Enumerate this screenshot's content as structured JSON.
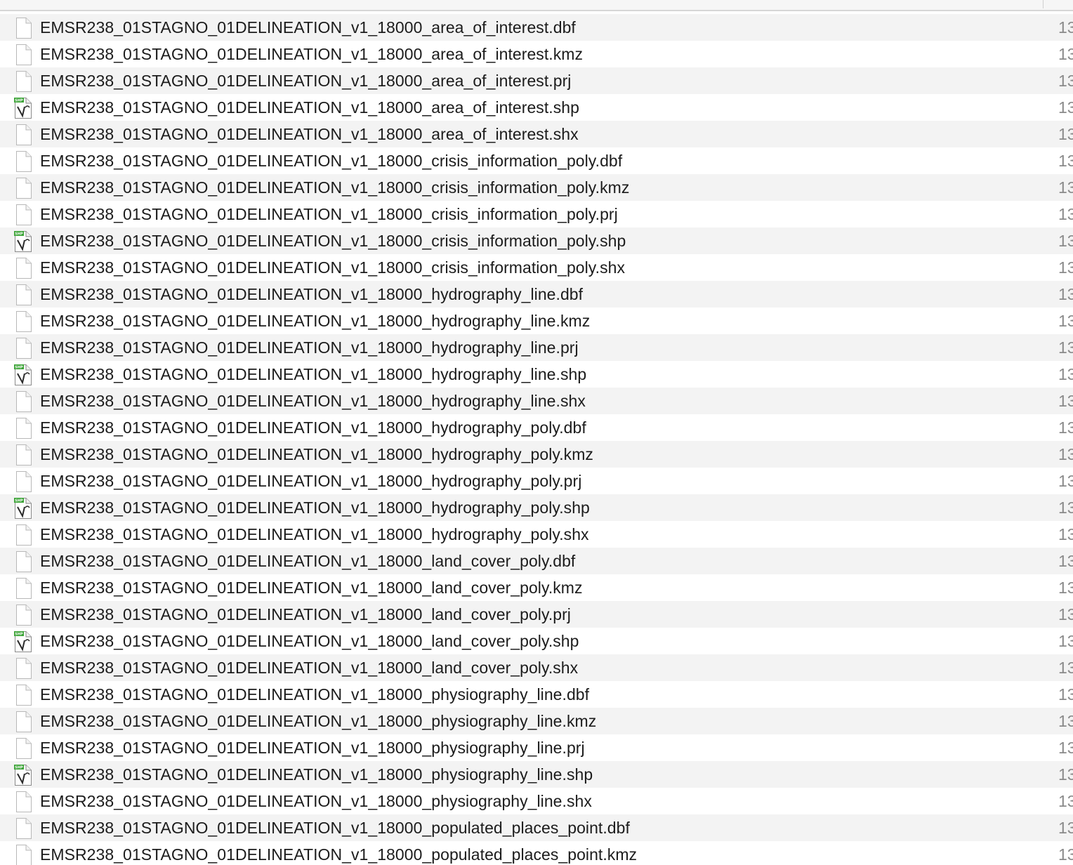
{
  "colors": {
    "row_alt": "#f3f3f3",
    "row_base": "#ffffff",
    "text": "#1c1c1c",
    "secondary_text": "#8a8a8a",
    "shp_badge": "#3aa335"
  },
  "files": [
    {
      "name": "EMSR238_01STAGNO_01DELINEATION_v1_18000_area_of_interest.dbf",
      "icon": "document-icon",
      "extra": "13"
    },
    {
      "name": "EMSR238_01STAGNO_01DELINEATION_v1_18000_area_of_interest.kmz",
      "icon": "document-icon",
      "extra": "13"
    },
    {
      "name": "EMSR238_01STAGNO_01DELINEATION_v1_18000_area_of_interest.prj",
      "icon": "document-icon",
      "extra": "13"
    },
    {
      "name": "EMSR238_01STAGNO_01DELINEATION_v1_18000_area_of_interest.shp",
      "icon": "shapefile-icon",
      "extra": "13"
    },
    {
      "name": "EMSR238_01STAGNO_01DELINEATION_v1_18000_area_of_interest.shx",
      "icon": "document-icon",
      "extra": "13"
    },
    {
      "name": "EMSR238_01STAGNO_01DELINEATION_v1_18000_crisis_information_poly.dbf",
      "icon": "document-icon",
      "extra": "13"
    },
    {
      "name": "EMSR238_01STAGNO_01DELINEATION_v1_18000_crisis_information_poly.kmz",
      "icon": "document-icon",
      "extra": "13"
    },
    {
      "name": "EMSR238_01STAGNO_01DELINEATION_v1_18000_crisis_information_poly.prj",
      "icon": "document-icon",
      "extra": "13"
    },
    {
      "name": "EMSR238_01STAGNO_01DELINEATION_v1_18000_crisis_information_poly.shp",
      "icon": "shapefile-icon",
      "extra": "13"
    },
    {
      "name": "EMSR238_01STAGNO_01DELINEATION_v1_18000_crisis_information_poly.shx",
      "icon": "document-icon",
      "extra": "13"
    },
    {
      "name": "EMSR238_01STAGNO_01DELINEATION_v1_18000_hydrography_line.dbf",
      "icon": "document-icon",
      "extra": "13"
    },
    {
      "name": "EMSR238_01STAGNO_01DELINEATION_v1_18000_hydrography_line.kmz",
      "icon": "document-icon",
      "extra": "13"
    },
    {
      "name": "EMSR238_01STAGNO_01DELINEATION_v1_18000_hydrography_line.prj",
      "icon": "document-icon",
      "extra": "13"
    },
    {
      "name": "EMSR238_01STAGNO_01DELINEATION_v1_18000_hydrography_line.shp",
      "icon": "shapefile-icon",
      "extra": "13"
    },
    {
      "name": "EMSR238_01STAGNO_01DELINEATION_v1_18000_hydrography_line.shx",
      "icon": "document-icon",
      "extra": "13"
    },
    {
      "name": "EMSR238_01STAGNO_01DELINEATION_v1_18000_hydrography_poly.dbf",
      "icon": "document-icon",
      "extra": "13"
    },
    {
      "name": "EMSR238_01STAGNO_01DELINEATION_v1_18000_hydrography_poly.kmz",
      "icon": "document-icon",
      "extra": "13"
    },
    {
      "name": "EMSR238_01STAGNO_01DELINEATION_v1_18000_hydrography_poly.prj",
      "icon": "document-icon",
      "extra": "13"
    },
    {
      "name": "EMSR238_01STAGNO_01DELINEATION_v1_18000_hydrography_poly.shp",
      "icon": "shapefile-icon",
      "extra": "13"
    },
    {
      "name": "EMSR238_01STAGNO_01DELINEATION_v1_18000_hydrography_poly.shx",
      "icon": "document-icon",
      "extra": "13"
    },
    {
      "name": "EMSR238_01STAGNO_01DELINEATION_v1_18000_land_cover_poly.dbf",
      "icon": "document-icon",
      "extra": "13"
    },
    {
      "name": "EMSR238_01STAGNO_01DELINEATION_v1_18000_land_cover_poly.kmz",
      "icon": "document-icon",
      "extra": "13"
    },
    {
      "name": "EMSR238_01STAGNO_01DELINEATION_v1_18000_land_cover_poly.prj",
      "icon": "document-icon",
      "extra": "13"
    },
    {
      "name": "EMSR238_01STAGNO_01DELINEATION_v1_18000_land_cover_poly.shp",
      "icon": "shapefile-icon",
      "extra": "13"
    },
    {
      "name": "EMSR238_01STAGNO_01DELINEATION_v1_18000_land_cover_poly.shx",
      "icon": "document-icon",
      "extra": "13"
    },
    {
      "name": "EMSR238_01STAGNO_01DELINEATION_v1_18000_physiography_line.dbf",
      "icon": "document-icon",
      "extra": "13"
    },
    {
      "name": "EMSR238_01STAGNO_01DELINEATION_v1_18000_physiography_line.kmz",
      "icon": "document-icon",
      "extra": "13"
    },
    {
      "name": "EMSR238_01STAGNO_01DELINEATION_v1_18000_physiography_line.prj",
      "icon": "document-icon",
      "extra": "13"
    },
    {
      "name": "EMSR238_01STAGNO_01DELINEATION_v1_18000_physiography_line.shp",
      "icon": "shapefile-icon",
      "extra": "13"
    },
    {
      "name": "EMSR238_01STAGNO_01DELINEATION_v1_18000_physiography_line.shx",
      "icon": "document-icon",
      "extra": "13"
    },
    {
      "name": "EMSR238_01STAGNO_01DELINEATION_v1_18000_populated_places_point.dbf",
      "icon": "document-icon",
      "extra": "13"
    },
    {
      "name": "EMSR238_01STAGNO_01DELINEATION_v1_18000_populated_places_point.kmz",
      "icon": "document-icon",
      "extra": "13"
    }
  ]
}
